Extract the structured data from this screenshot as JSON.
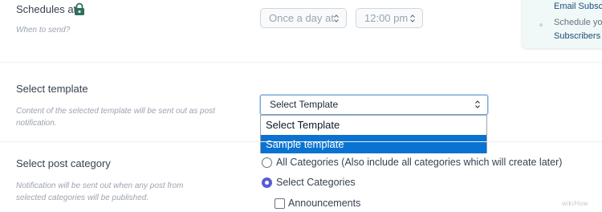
{
  "schedule": {
    "label": "Schedules at",
    "help": "When to send?",
    "frequency_value": "Once a day at",
    "time_value": "12:00 pm"
  },
  "side_panel": {
    "line1": "Email Subsc",
    "line2": "Schedule yo",
    "line3": "Subscribers"
  },
  "template": {
    "label": "Select template",
    "help_line1": "Content of the selected template will be sent out as post",
    "help_line2": "notification.",
    "selected_value": "Select Template",
    "options": [
      "Select Template",
      "Sample template"
    ],
    "highlighted_index": 1
  },
  "category": {
    "label": "Select post category",
    "help_line1": "Notification will be sent out when any post from",
    "help_line2": "selected categories will be published.",
    "radio_all_label": "All Categories (Also include all categories which will create later)",
    "radio_select_label": "Select Categories",
    "checkbox_announcements_label": "Announcements",
    "selected_radio": "Select Categories"
  },
  "watermark": "wikiHow",
  "colors": {
    "accent_radio": "#5b5bd6",
    "dropdown_highlight": "#0a72d0",
    "lock_icon": "#2f6f5e",
    "panel_link": "#1f4e79"
  }
}
